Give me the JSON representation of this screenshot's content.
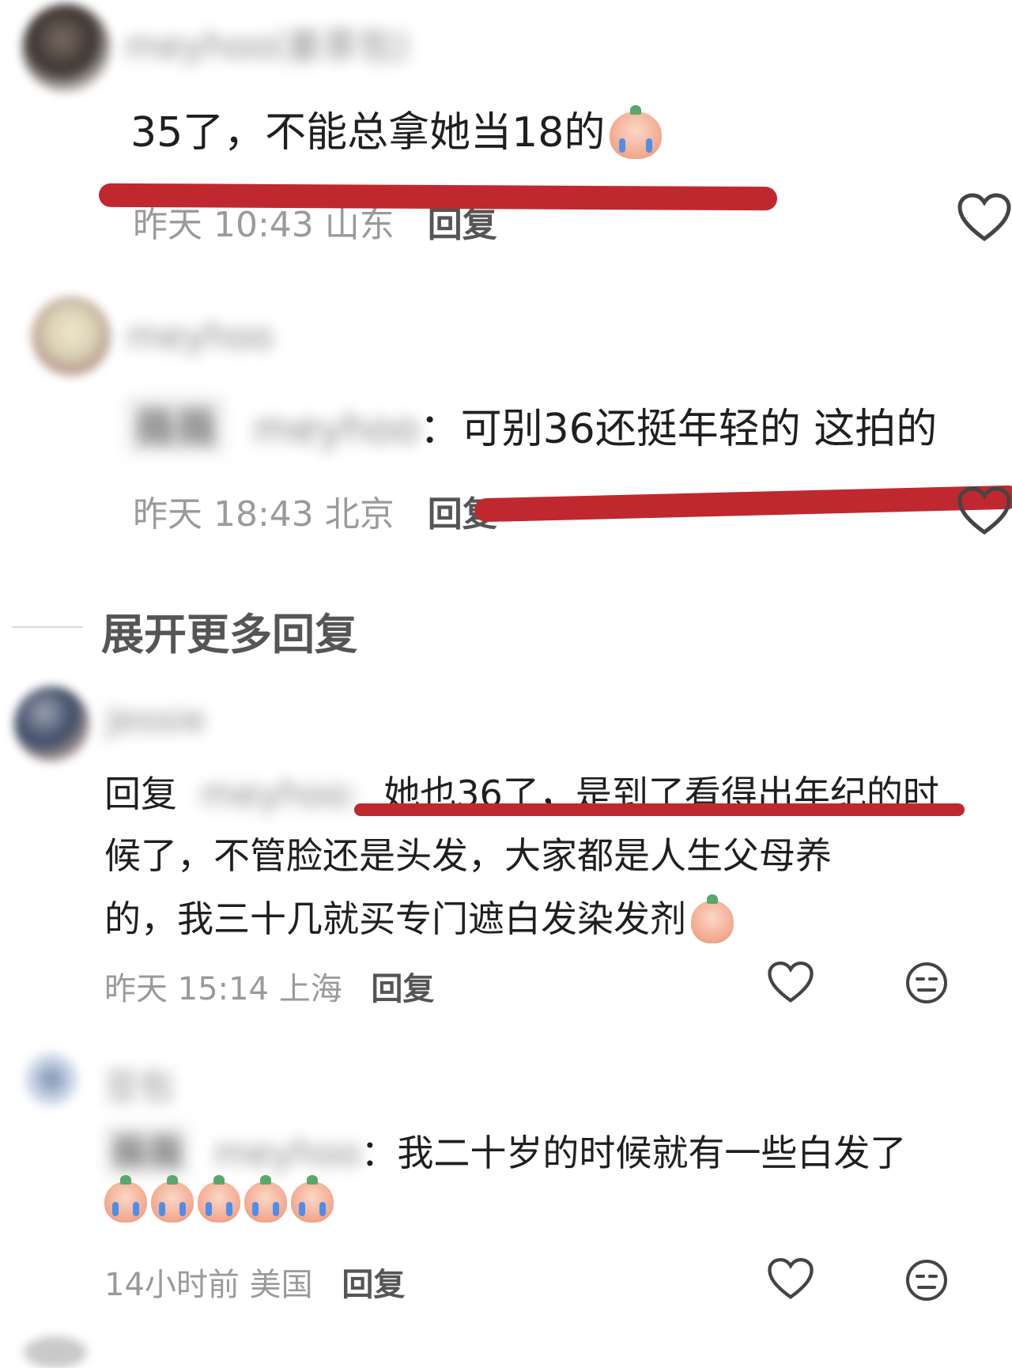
{
  "comment1": {
    "username": "meyhoo(姜茶包)",
    "text": "35了，不能总拿她当18的",
    "time": "昨天 10:43 山东",
    "reply_label": "回复"
  },
  "reply1": {
    "username": "meyhoo",
    "tag_user": "薇薇",
    "to_user": "meyhoo",
    "colon": "：",
    "text": "可别36还挺年轻的 这拍的",
    "time": "昨天 18:43 北京",
    "reply_label": "回复"
  },
  "expand": {
    "label": "展开更多回复"
  },
  "comment2": {
    "username": "Jessie",
    "reply_prefix": "回复",
    "to_user": "meyhoo:",
    "line1": "她也36了，是到了看得出年纪的时",
    "line2": "候了，不管脸还是头发，大家都是人生父母养",
    "line3": "的，我三十几就买专门遮白发染发剂",
    "time": "昨天 15:14 上海",
    "reply_label": "回复"
  },
  "comment3": {
    "username": "豆包",
    "tag_user": "薇薇",
    "to_user": "meyhoo",
    "colon": "：",
    "text": "我二十岁的时候就有一些白发了",
    "time": "14小时前 美国",
    "reply_label": "回复"
  },
  "colors": {
    "annotation_red": "#c0282f",
    "meta_gray": "#9a9a9a"
  }
}
